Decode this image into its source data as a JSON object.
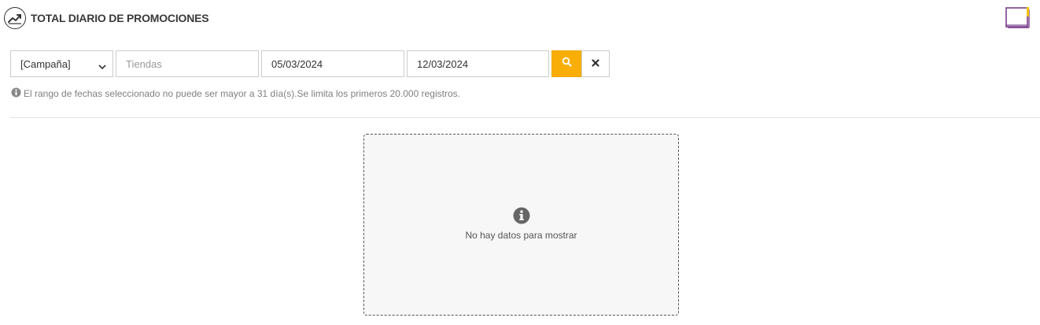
{
  "header": {
    "title": "TOTAL DIARIO DE PROMOCIONES",
    "icon": "trend-chart-icon",
    "manual_icon": "book-icon"
  },
  "filters": {
    "campaign_select": {
      "value": "[Campaña]"
    },
    "stores_input": {
      "value": "",
      "placeholder": "Tiendas"
    },
    "date_from": {
      "value": "05/03/2024"
    },
    "date_to": {
      "value": "12/03/2024"
    },
    "search_icon": "search-icon",
    "clear_icon": "close-icon"
  },
  "note": {
    "text": "El rango de fechas seleccionado no puede ser mayor a 31 día(s).Se limita los primeros 20.000 registros."
  },
  "empty_state": {
    "message": "No hay datos para mostrar"
  },
  "colors": {
    "accent": "#f9ae07",
    "book_purple": "#7b3f8c",
    "book_yellow": "#f5c400"
  }
}
